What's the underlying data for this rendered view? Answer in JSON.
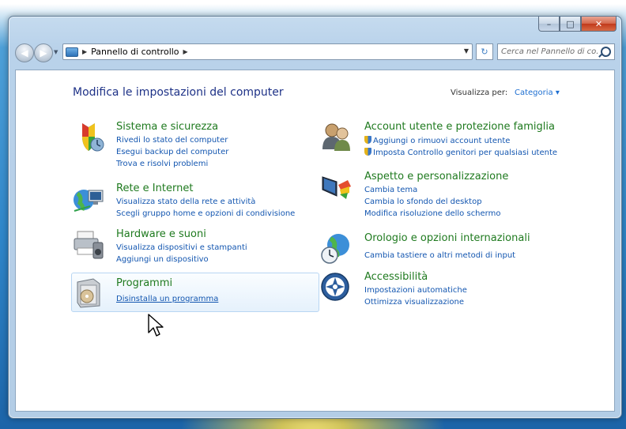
{
  "window": {
    "caption_buttons": {
      "minimize": "–",
      "maximize": "□",
      "close": "✕"
    }
  },
  "nav": {
    "back_icon": "back-arrow-icon",
    "forward_icon": "forward-arrow-icon",
    "breadcrumb": [
      "Pannello di controllo"
    ],
    "search_placeholder": "Cerca nel Pannello di co..."
  },
  "page": {
    "title": "Modifica le impostazioni del computer",
    "view_by_label": "Visualizza per:",
    "view_by_value": "Categoria ▾"
  },
  "categories": [
    {
      "name": "Sistema e sicurezza",
      "icon": "shield-icon",
      "links": [
        "Rivedi lo stato del computer",
        "Esegui backup del computer",
        "Trova e risolvi problemi"
      ]
    },
    {
      "name": "Rete e Internet",
      "icon": "network-globe-icon",
      "links": [
        "Visualizza stato della rete e attività",
        "Scegli gruppo home e opzioni di condivisione"
      ]
    },
    {
      "name": "Hardware e suoni",
      "icon": "printer-icon",
      "links": [
        "Visualizza dispositivi e stampanti",
        "Aggiungi un dispositivo"
      ]
    },
    {
      "name": "Programmi",
      "icon": "programs-box-icon",
      "links": [
        "Disinstalla un programma"
      ]
    },
    {
      "name": "Account utente e protezione famiglia",
      "icon": "users-icon",
      "links": [
        "Aggiungi o rimuovi account utente",
        "Imposta Controllo genitori per qualsiasi utente"
      ]
    },
    {
      "name": "Aspetto e personalizzazione",
      "icon": "display-paint-icon",
      "links": [
        "Cambia tema",
        "Cambia lo sfondo del desktop",
        "Modifica risoluzione dello schermo"
      ]
    },
    {
      "name": "Orologio e opzioni internazionali",
      "icon": "globe-clock-icon",
      "links": [
        "Cambia tastiere o altri metodi di input"
      ]
    },
    {
      "name": "Accessibilità",
      "icon": "accessibility-icon",
      "links": [
        "Impostazioni automatiche",
        "Ottimizza visualizzazione"
      ]
    }
  ]
}
